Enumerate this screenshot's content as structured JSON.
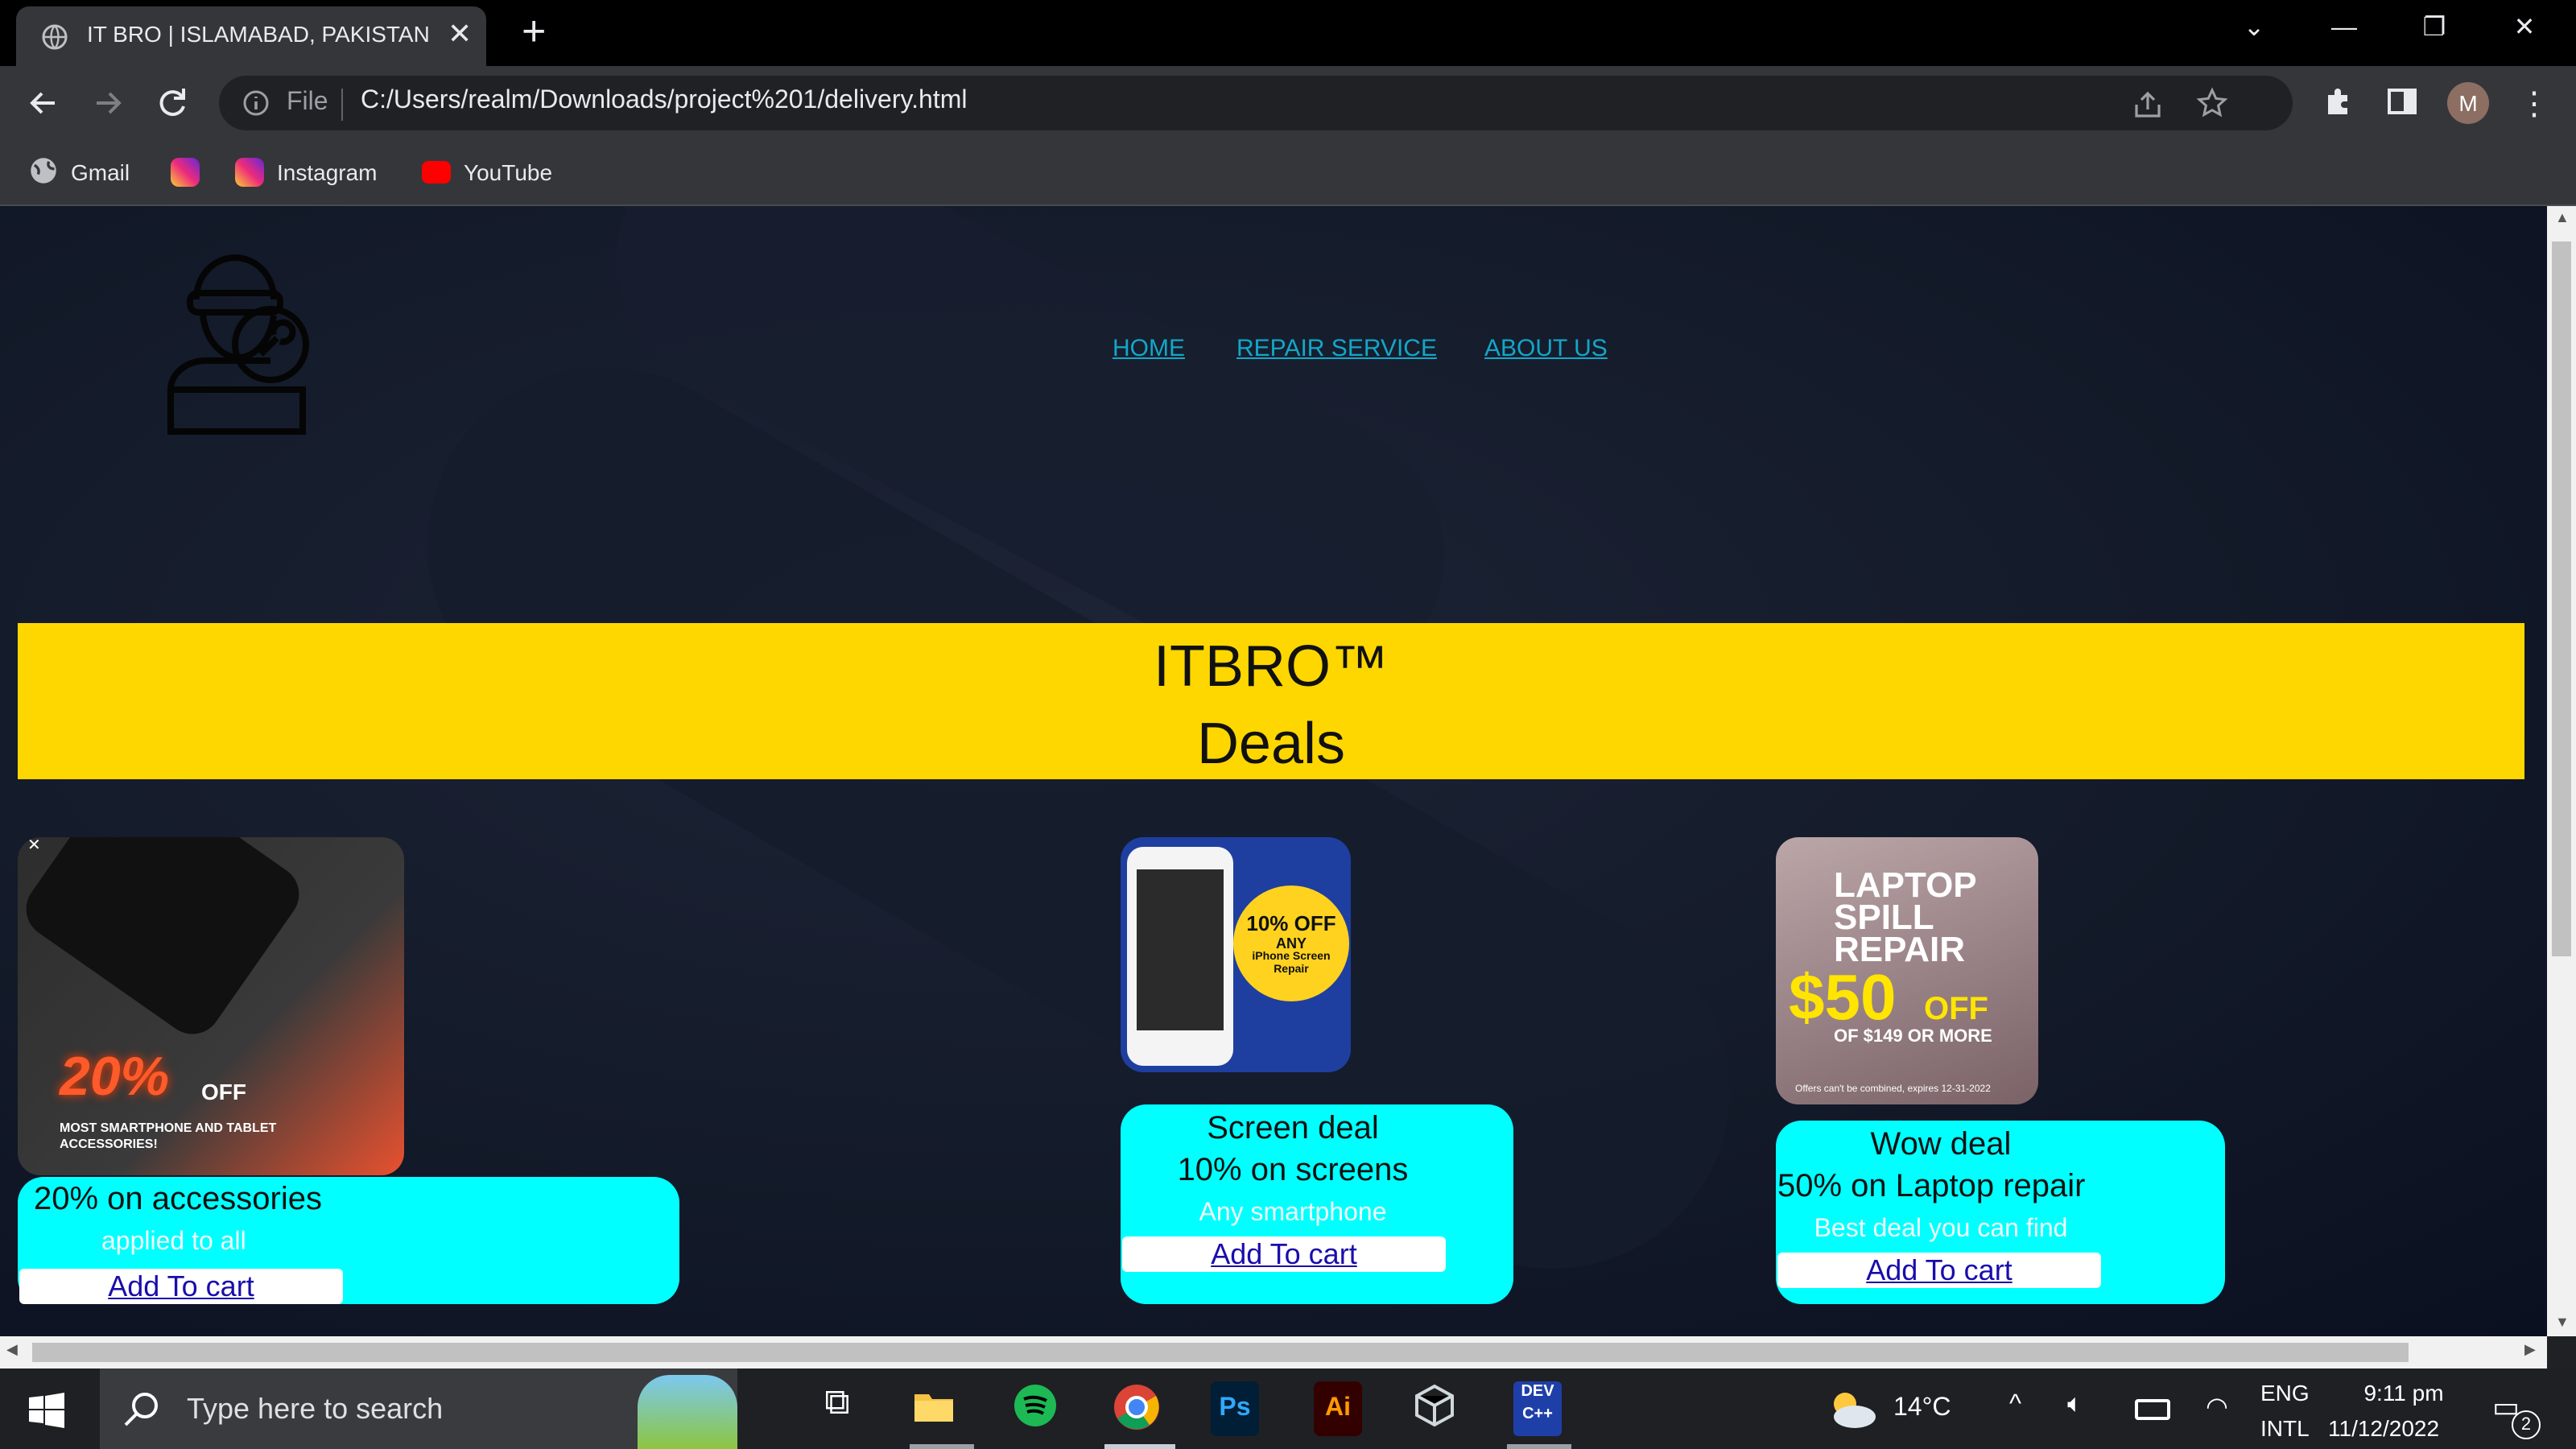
{
  "browser": {
    "tab_title": "IT BRO | ISLAMABAD, PAKISTAN",
    "url_scheme": "File",
    "url": "C:/Users/realm/Downloads/project%201/delivery.html",
    "profile_initial": "M",
    "bookmarks": [
      "Gmail",
      "Instagram",
      "YouTube"
    ]
  },
  "page": {
    "nav": [
      "HOME",
      "REPAIR SERVICE",
      "ABOUT US"
    ],
    "banner_line1": "ITBRO™",
    "banner_line2": "Deals",
    "cards": [
      {
        "image_text_big": "20%",
        "image_text_off": "OFF",
        "image_caption": "MOST SMARTPHONE AND TABLET ACCESSORIES!",
        "title": "20% on accessories",
        "subtitle": "applied to all",
        "button": "Add To cart"
      },
      {
        "image_badge_1": "10% OFF",
        "image_badge_2": "ANY",
        "image_badge_3": "iPhone Screen Repair",
        "title": "Screen deal",
        "line2": "10% on screens",
        "subtitle": "Any smartphone",
        "button": "Add To cart"
      },
      {
        "image_line1": "LAPTOP",
        "image_line2": "SPILL",
        "image_line3": "REPAIR",
        "image_price": "$50",
        "image_off": "OFF",
        "image_cond": "OF $149 OR MORE",
        "image_fine": "Offers can't be combined, expires 12-31-2022",
        "title": "Wow deal",
        "line2": "50% on Laptop repair",
        "subtitle": "Best deal you can find",
        "button": "Add To cart"
      }
    ]
  },
  "taskbar": {
    "search_placeholder": "Type here to search",
    "weather": "14°C",
    "lang1": "ENG",
    "lang2": "INTL",
    "time": "9:11 pm",
    "date": "11/12/2022",
    "notifications": "2",
    "apps": [
      "task-view",
      "file-explorer",
      "spotify",
      "chrome",
      "photoshop",
      "illustrator",
      "virtualbox",
      "devcpp"
    ]
  },
  "colors": {
    "banner": "#ffd700",
    "card_box": "#00ffff",
    "nav_link": "#12a7c9"
  }
}
